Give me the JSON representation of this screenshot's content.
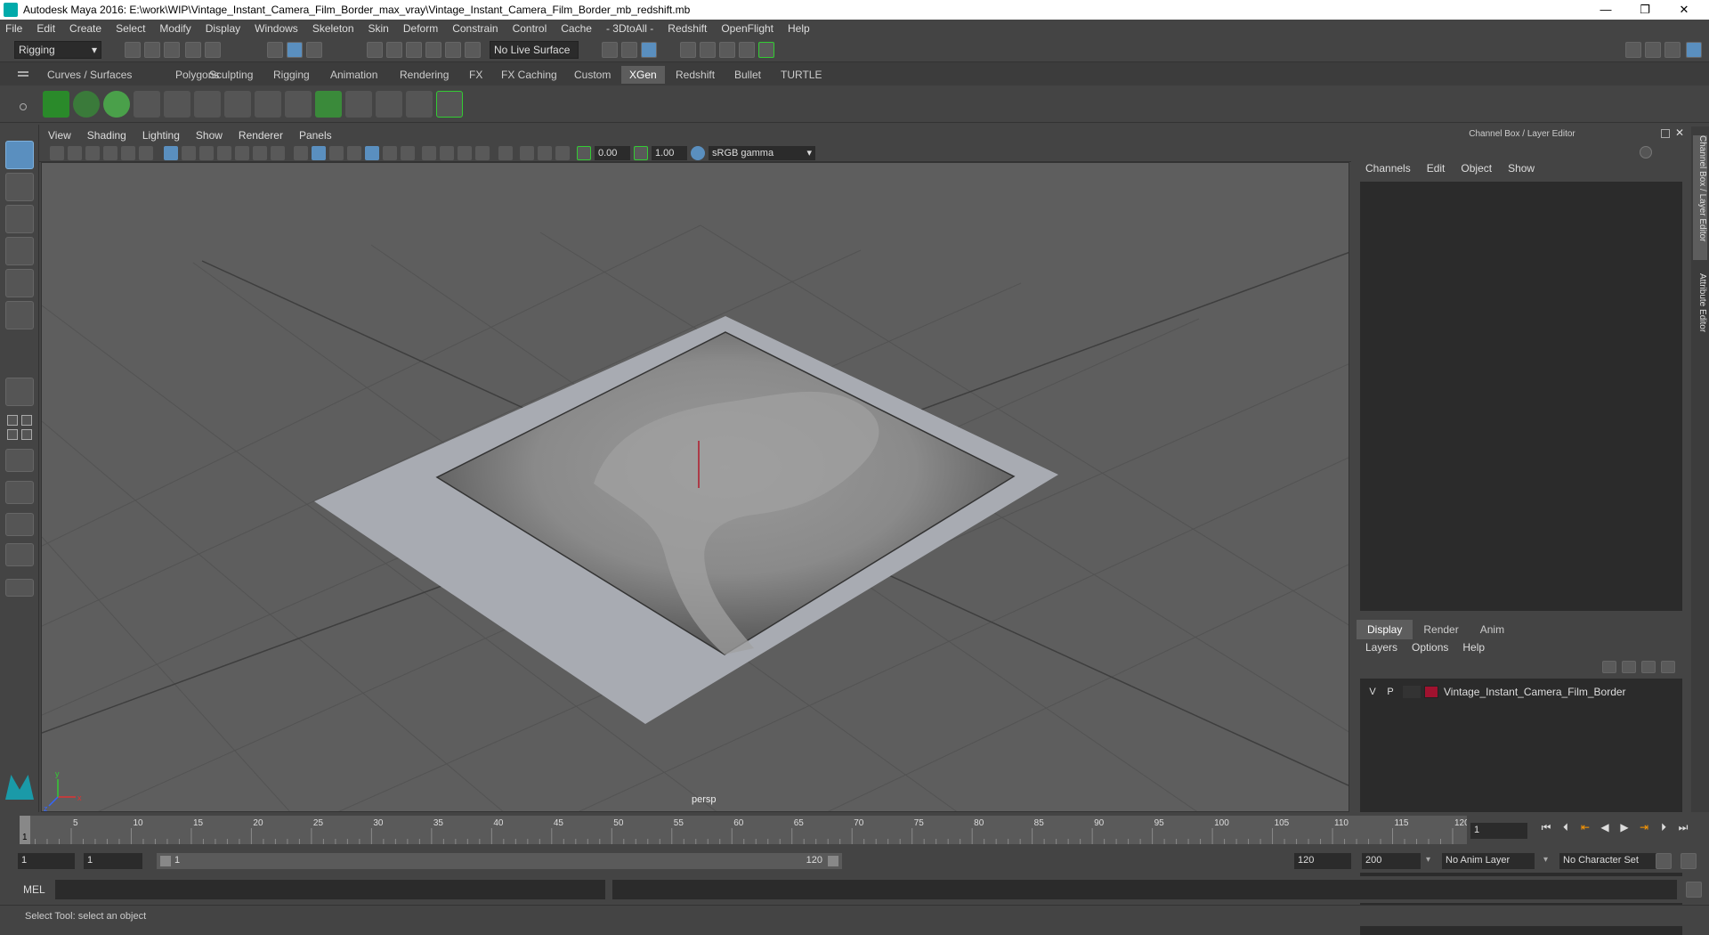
{
  "window": {
    "title": "Autodesk Maya 2016: E:\\work\\WIP\\Vintage_Instant_Camera_Film_Border_max_vray\\Vintage_Instant_Camera_Film_Border_mb_redshift.mb",
    "minimize": "—",
    "restore": "❐",
    "close": "✕"
  },
  "menubar": [
    "File",
    "Edit",
    "Create",
    "Select",
    "Modify",
    "Display",
    "Windows",
    "Skeleton",
    "Skin",
    "Deform",
    "Constrain",
    "Control",
    "Cache",
    "- 3DtoAll -",
    "Redshift",
    "OpenFlight",
    "Help"
  ],
  "statusline": {
    "menuset": "Rigging",
    "live_surface": "No Live Surface"
  },
  "shelf_tabs": [
    {
      "label": "Curves / Surfaces"
    },
    {
      "label": "Polygons"
    },
    {
      "label": "Sculpting"
    },
    {
      "label": "Rigging"
    },
    {
      "label": "Animation"
    },
    {
      "label": "Rendering"
    },
    {
      "label": "FX"
    },
    {
      "label": "FX Caching"
    },
    {
      "label": "Custom"
    },
    {
      "label": "XGen",
      "active": true
    },
    {
      "label": "Redshift"
    },
    {
      "label": "Bullet"
    },
    {
      "label": "TURTLE"
    }
  ],
  "panel_menu": [
    "View",
    "Shading",
    "Lighting",
    "Show",
    "Renderer",
    "Panels"
  ],
  "panel_toolbar": {
    "exposure": "0.00",
    "gamma": "1.00",
    "colorspace": "sRGB gamma"
  },
  "viewport": {
    "camera_label": "persp",
    "axis": {
      "x": "x",
      "y": "y",
      "z": "z"
    }
  },
  "channel_box": {
    "title": "Channel Box / Layer Editor",
    "menu": [
      "Channels",
      "Edit",
      "Object",
      "Show"
    ]
  },
  "layer_editor": {
    "tabs": [
      {
        "label": "Display",
        "active": true
      },
      {
        "label": "Render"
      },
      {
        "label": "Anim"
      }
    ],
    "menu": [
      "Layers",
      "Options",
      "Help"
    ],
    "layers": [
      {
        "visible": "V",
        "playback": "P",
        "color": "#a0122f",
        "name": "Vintage_Instant_Camera_Film_Border"
      }
    ]
  },
  "side_tabs": [
    "Channel Box / Layer Editor",
    "Attribute Editor"
  ],
  "timeline": {
    "start": 1,
    "end": 120,
    "current_frame": "1",
    "labels": [
      "5",
      "10",
      "15",
      "20",
      "25",
      "30",
      "35",
      "40",
      "45",
      "50",
      "55",
      "60",
      "65",
      "70",
      "75",
      "80",
      "85",
      "90",
      "95",
      "100",
      "105",
      "110",
      "115",
      "120"
    ]
  },
  "range": {
    "start_field": "1",
    "playback_start": "1",
    "slider_start": "1",
    "slider_end": "120",
    "playback_end": "120",
    "end_field": "200",
    "anim_layer": "No Anim Layer",
    "character_set": "No Character Set"
  },
  "command": {
    "language": "MEL"
  },
  "help_line": "Select Tool: select an object",
  "colors": {
    "accent": "#5a8fbf",
    "layer_color": "#a0122f",
    "viewport_bg": "#5e5e5e"
  }
}
